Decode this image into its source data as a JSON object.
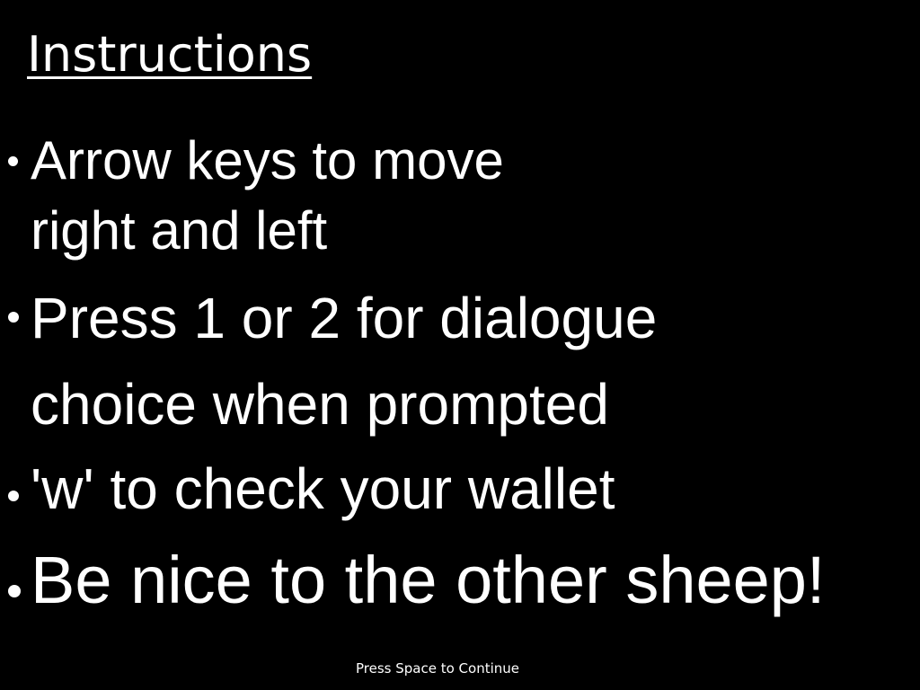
{
  "screen": {
    "title": "Instructions",
    "background_color": "#000000",
    "text_color": "#ffffff",
    "items": [
      {
        "line1": "Arrow keys to move",
        "line2": "right and left"
      },
      {
        "line1": "Press 1 or 2 for dialogue",
        "line2": "choice when prompted"
      },
      {
        "line1": "'w' to check your wallet"
      },
      {
        "line1": "Be nice to the other sheep!"
      }
    ],
    "footer": "Press Space to Continue"
  }
}
